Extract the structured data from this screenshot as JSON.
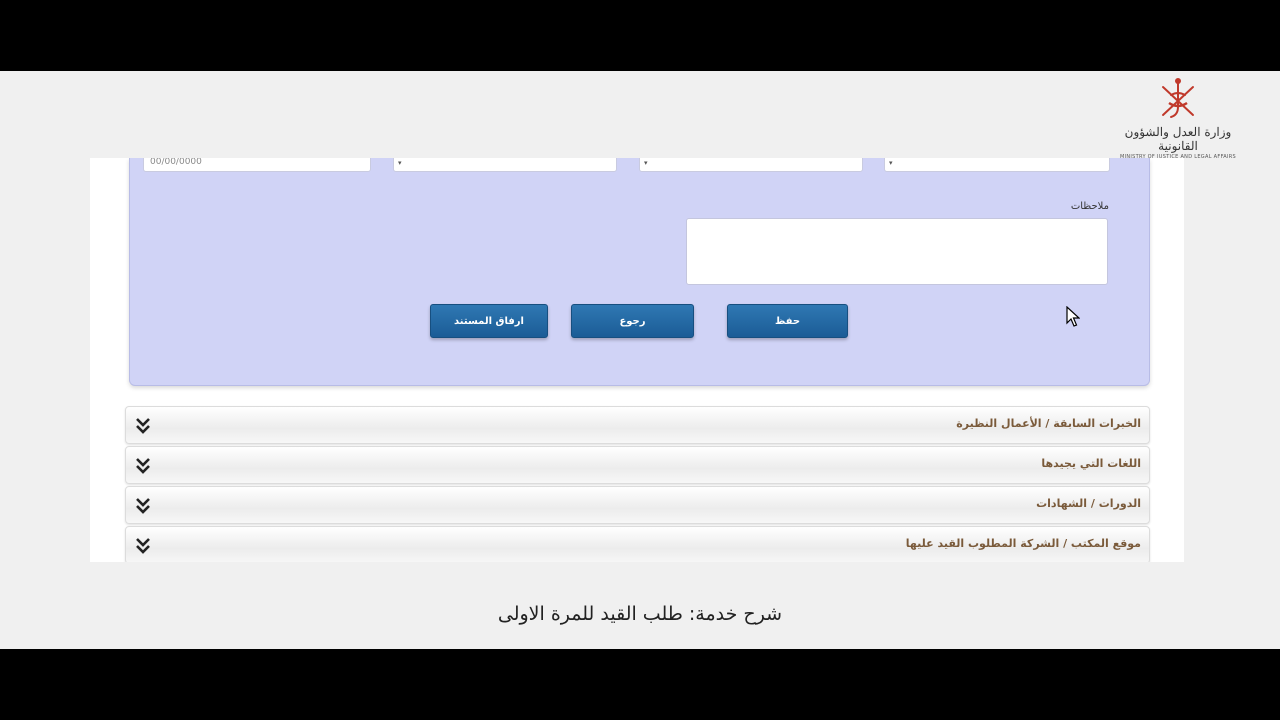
{
  "logo": {
    "arabic": "وزارة العدل والشؤون القانونية",
    "english": "MINISTRY OF JUSTICE AND LEGAL AFFAIRS",
    "icon": "oman-emblem-icon",
    "color": "#c0392b"
  },
  "form": {
    "top_fields": [
      {
        "value": "00/00/0000"
      },
      {
        "value": ""
      },
      {
        "value": ""
      },
      {
        "value": ""
      }
    ],
    "notes_label": "ملاحظات",
    "notes_value": "",
    "buttons": {
      "save": "حفظ",
      "back": "رجوع",
      "attach": "ارفاق المستند"
    },
    "panel_color": "#d0d3f6",
    "button_color": "#1f65a3"
  },
  "sections": [
    {
      "title": "الخبرات السابقة / الأعمال النظيرة"
    },
    {
      "title": "اللغات التي يجيدها"
    },
    {
      "title": "الدورات / الشهادات"
    },
    {
      "title": "موقع المكتب / الشركة المطلوب القيد عليها"
    }
  ],
  "caption": "شرح خدمة: طلب القيد للمرة الاولى"
}
